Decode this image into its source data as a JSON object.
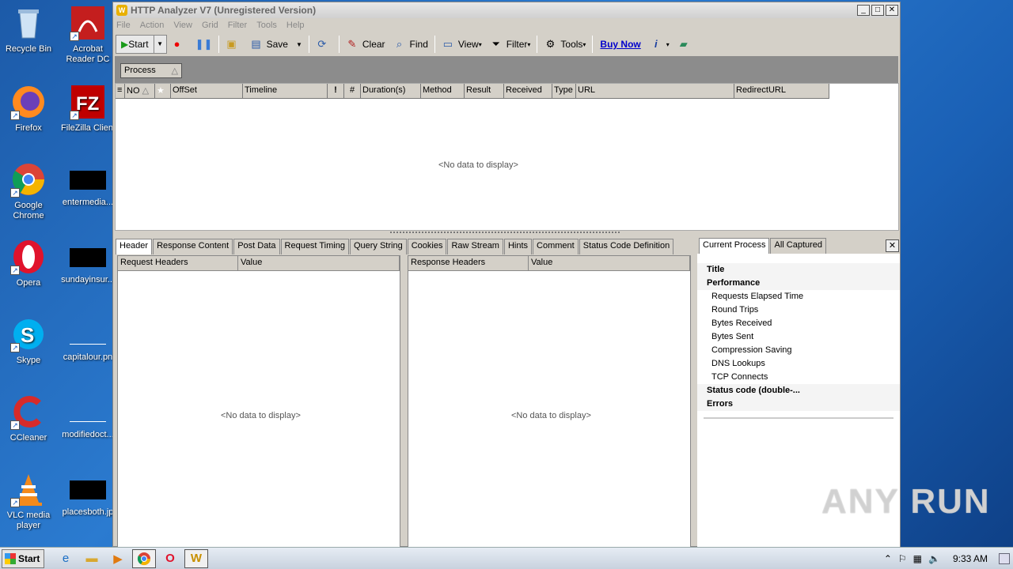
{
  "desktop": {
    "icons": [
      {
        "label": "Recycle Bin"
      },
      {
        "label": "Acrobat Reader DC"
      },
      {
        "label": "Firefox"
      },
      {
        "label": "FileZilla Client"
      },
      {
        "label": "Google Chrome"
      },
      {
        "label": "entermedia..."
      },
      {
        "label": "Opera"
      },
      {
        "label": "sundayinsur..."
      },
      {
        "label": "Skype"
      },
      {
        "label": "capitalour.pn"
      },
      {
        "label": "CCleaner"
      },
      {
        "label": "modifiedoct..."
      },
      {
        "label": "VLC media player"
      },
      {
        "label": "placesboth.jp"
      }
    ]
  },
  "window": {
    "title": "HTTP Analyzer V7  (Unregistered Version)",
    "controls": {
      "minimize": "_",
      "maximize": "□",
      "close": "✕"
    }
  },
  "menu": [
    "File",
    "Action",
    "View",
    "Grid",
    "Filter",
    "Tools",
    "Help"
  ],
  "toolbar": {
    "start": "Start",
    "save": "Save",
    "clear": "Clear",
    "find": "Find",
    "view": "View",
    "filter": "Filter",
    "tools": "Tools",
    "buy_now": "Buy Now"
  },
  "group": {
    "process_label": "Process",
    "sort_glyph": "△"
  },
  "grid": {
    "columns": [
      "NO",
      "OffSet",
      "Timeline",
      "!",
      "#",
      "Duration(s)",
      "Method",
      "Result",
      "Received",
      "Type",
      "URL",
      "RedirectURL"
    ],
    "no_data": "<No data to display>"
  },
  "tabs": [
    "Header",
    "Response Content",
    "Post Data",
    "Request Timing",
    "Query String",
    "Cookies",
    "Raw Stream",
    "Hints",
    "Comment",
    "Status Code Definition"
  ],
  "request_panel": {
    "col1": "Request Headers",
    "col2": "Value",
    "no_data": "<No data to display>"
  },
  "response_panel": {
    "col1": "Response Headers",
    "col2": "Value",
    "no_data": "<No data to display>"
  },
  "right_panel": {
    "tabs": [
      "Current Process",
      "All Captured"
    ],
    "rows": [
      {
        "text": "Title",
        "kind": "bold"
      },
      {
        "text": "Performance",
        "kind": "bold"
      },
      {
        "text": "Requests Elapsed Time",
        "kind": "sub"
      },
      {
        "text": "Round Trips",
        "kind": "sub"
      },
      {
        "text": "Bytes Received",
        "kind": "sub"
      },
      {
        "text": "Bytes Sent",
        "kind": "sub"
      },
      {
        "text": "Compression Saving",
        "kind": "sub"
      },
      {
        "text": "DNS Lookups",
        "kind": "sub"
      },
      {
        "text": "TCP Connects",
        "kind": "sub"
      },
      {
        "text": "Status code (double-...",
        "kind": "bold"
      },
      {
        "text": "Errors",
        "kind": "bold"
      }
    ]
  },
  "taskbar": {
    "start": "Start",
    "clock": "9:33 AM"
  },
  "watermark": "ANY RUN"
}
